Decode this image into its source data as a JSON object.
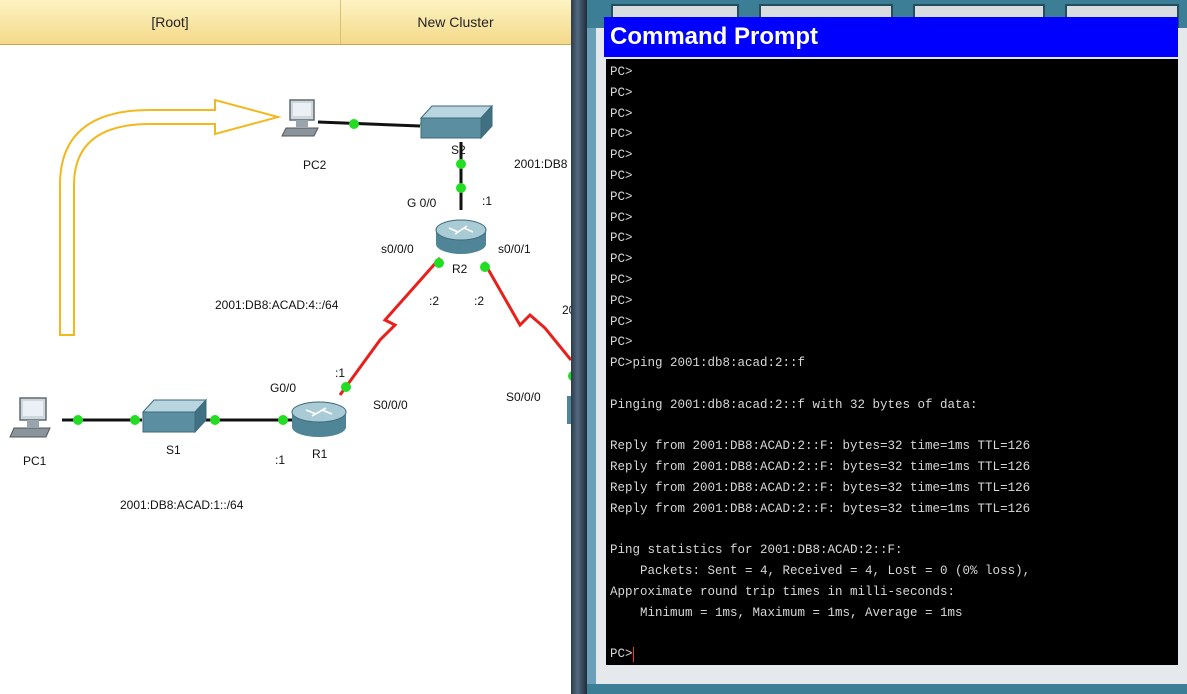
{
  "breadcrumb": {
    "root_label": "[Root]",
    "cluster_label": "New Cluster"
  },
  "topology": {
    "devices": {
      "pc1": "PC1",
      "pc2": "PC2",
      "s1": "S1",
      "s2": "S2",
      "r1": "R1",
      "r2": "R2"
    },
    "interface_labels": {
      "r2_g00": "G 0/0",
      "r2_g00_addr": ":1",
      "r2_s000": "s0/0/0",
      "r2_s001": "s0/0/1",
      "r2_s000_addr": ":2",
      "r2_s001_addr": ":2",
      "r1_g00": "G0/0",
      "r1_s000": "S0/0/0",
      "r1_s000_addr": ":1",
      "r1_g00_addr": ":1",
      "r3_s000": "S0/0/0"
    },
    "networks": {
      "lan2": "2001:DB8",
      "serial_r1_r2": "2001:DB8:ACAD:4::/64",
      "lan1": "2001:DB8:ACAD:1::/64",
      "serial_r2_r3": "20"
    },
    "colors": {
      "serial_link": "#e8201c",
      "ethernet_link": "#111111",
      "link_up_dot": "#22dd22",
      "arrow": "#f2b91f"
    }
  },
  "command_prompt": {
    "title": "Command Prompt",
    "lines": [
      "PC>",
      "PC>",
      "PC>",
      "PC>",
      "PC>",
      "PC>",
      "PC>",
      "PC>",
      "PC>",
      "PC>",
      "PC>",
      "PC>",
      "PC>",
      "PC>",
      "PC>ping 2001:db8:acad:2::f",
      "",
      "Pinging 2001:db8:acad:2::f with 32 bytes of data:",
      "",
      "Reply from 2001:DB8:ACAD:2::F: bytes=32 time=1ms TTL=126",
      "Reply from 2001:DB8:ACAD:2::F: bytes=32 time=1ms TTL=126",
      "Reply from 2001:DB8:ACAD:2::F: bytes=32 time=1ms TTL=126",
      "Reply from 2001:DB8:ACAD:2::F: bytes=32 time=1ms TTL=126",
      "",
      "Ping statistics for 2001:DB8:ACAD:2::F:",
      "    Packets: Sent = 4, Received = 4, Lost = 0 (0% loss),",
      "Approximate round trip times in milli-seconds:",
      "    Minimum = 1ms, Maximum = 1ms, Average = 1ms",
      ""
    ],
    "prompt": "PC>"
  }
}
